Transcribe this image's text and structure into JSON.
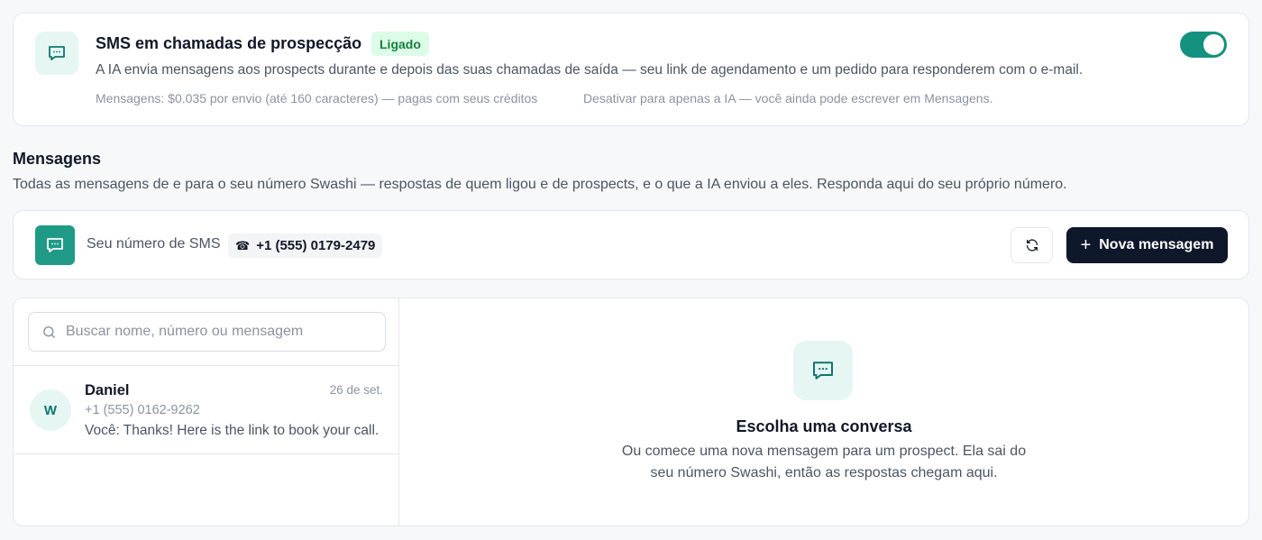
{
  "sms_card": {
    "icon": "chat-bubble-icon",
    "title": "SMS em chamadas de prospecção",
    "status_badge": "Ligado",
    "description": "A IA envia mensagens aos prospects durante e depois das suas chamadas de saída — seu link de agendamento e um pedido para responderem com o e-mail.",
    "note_pricing": "Mensagens: $0.035 por envio (até 160 caracteres) — pagas com seus créditos",
    "note_disable": "Desativar para apenas a IA — você ainda pode escrever em Mensagens.",
    "toggle_on": true
  },
  "messages_section": {
    "title": "Mensagens",
    "description": "Todas as mensagens de e para o seu número Swashi — respostas de quem ligou e de prospects, e o que a IA enviou a eles. Responda aqui do seu próprio número."
  },
  "number_bar": {
    "label": "Seu número de SMS",
    "phone_glyph": "☎",
    "number": "+1 (555) 0179-2479",
    "new_message_label": "Nova mensagem",
    "new_message_plus": "+"
  },
  "conversations": {
    "search": {
      "placeholder": "Buscar nome, número ou mensagem",
      "value": ""
    },
    "items": [
      {
        "avatar_initial": "W",
        "name": "Daniel",
        "date": "26 de set.",
        "phone": "+1 (555) 0162-9262",
        "preview": "Você: Thanks! Here is the link to book your call."
      }
    ]
  },
  "empty_state": {
    "title": "Escolha uma conversa",
    "description": "Ou comece uma nova mensagem para um prospect. Ela sai do seu número Swashi, então as respostas chegam aqui."
  },
  "colors": {
    "accent": "#14917f",
    "accent_light": "#e6f6f3",
    "badge_bg": "#dcfce7",
    "badge_text": "#15803d",
    "primary_button": "#0f172a"
  }
}
